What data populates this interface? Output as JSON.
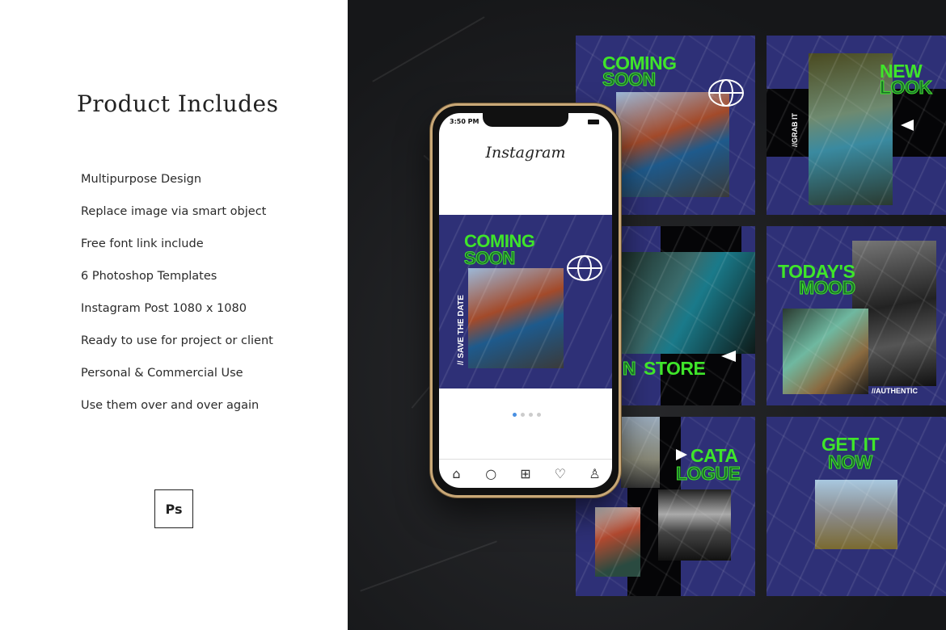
{
  "left_panel": {
    "title": "Product Includes",
    "features": [
      "Multipurpose Design",
      "Replace image via smart object",
      "Free font link include",
      "6 Photoshop Templates",
      "Instagram Post 1080 x 1080",
      "Ready to use for project or client",
      "Personal & Commercial Use",
      "Use them over and over again"
    ],
    "software_badge": "Ps"
  },
  "phone": {
    "status_time": "3:50 PM",
    "app_name": "Instagram",
    "post": {
      "headline": "COMING",
      "headline_outline": "SOON",
      "side_text": "// SAVE THE DATE"
    },
    "carousel": {
      "count": 4,
      "active": 1
    },
    "nav_icons": [
      "home-icon",
      "search-icon",
      "add-post-icon",
      "heart-icon",
      "profile-icon"
    ]
  },
  "tiles": [
    {
      "headline": "COMING",
      "outline": "SOON"
    },
    {
      "headline": "NEW",
      "outline": "LOOK",
      "side_text": "//GRAB IT"
    },
    {
      "headline": "STORE",
      "outline": "N"
    },
    {
      "headline": "TODAY'S",
      "outline": "MOOD",
      "tag": "//AUTHENTIC"
    },
    {
      "headline": "CATA",
      "outline": "LOGUE"
    },
    {
      "headline": "GET IT",
      "outline": "NOW"
    }
  ],
  "colors": {
    "tile_bg": "#2e3077",
    "accent_green": "#3fe52a",
    "dark_bg": "#1c1d1f",
    "phone_frame": "#c9a877"
  }
}
